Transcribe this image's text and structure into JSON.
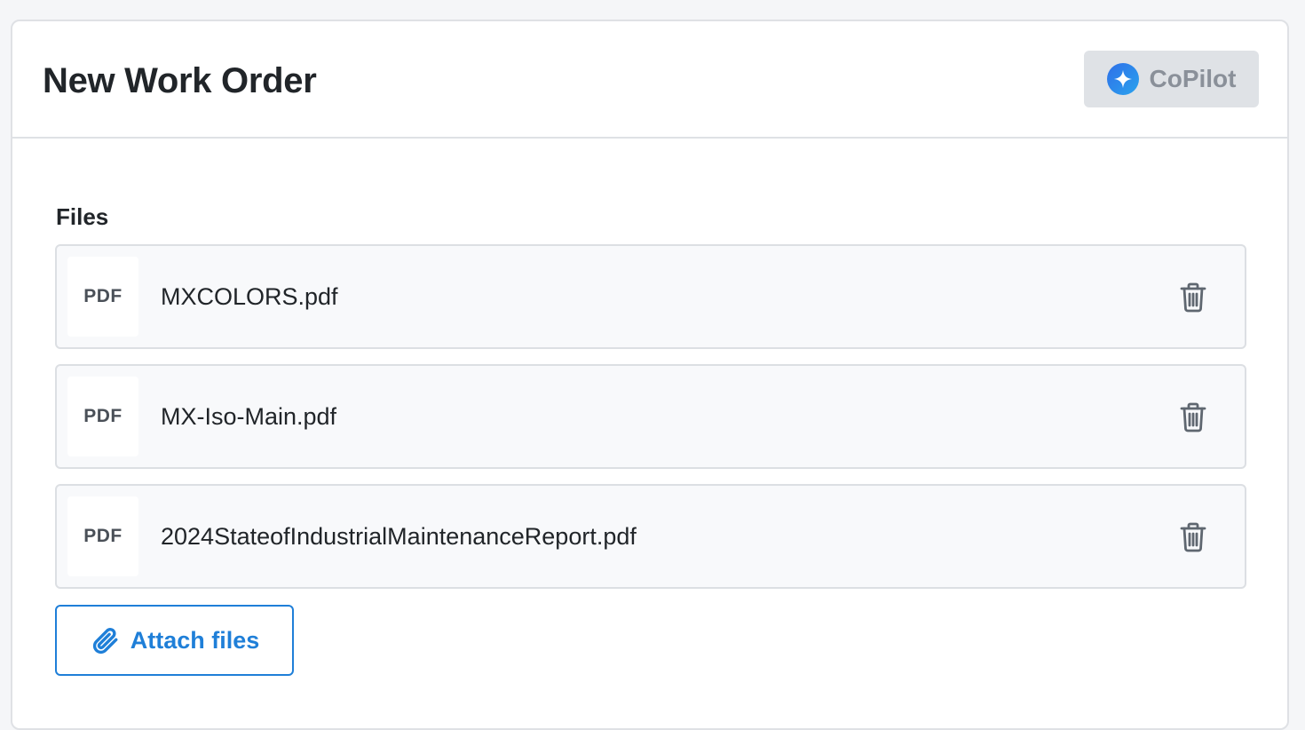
{
  "header": {
    "title": "New Work Order",
    "copilot_label": "CoPilot",
    "copilot_icon": "sparkle-icon"
  },
  "files": {
    "label": "Files",
    "items": [
      {
        "type": "PDF",
        "name": "MXCOLORS.pdf"
      },
      {
        "type": "PDF",
        "name": "MX-Iso-Main.pdf"
      },
      {
        "type": "PDF",
        "name": "2024StateofIndustrialMaintenanceReport.pdf"
      }
    ],
    "delete_icon": "trash-icon",
    "attach_label": "Attach files",
    "attach_icon": "paperclip-icon"
  },
  "colors": {
    "accent": "#1f7fd8",
    "copilot_bg": "#dfe2e6",
    "border": "#dfe1e5"
  }
}
